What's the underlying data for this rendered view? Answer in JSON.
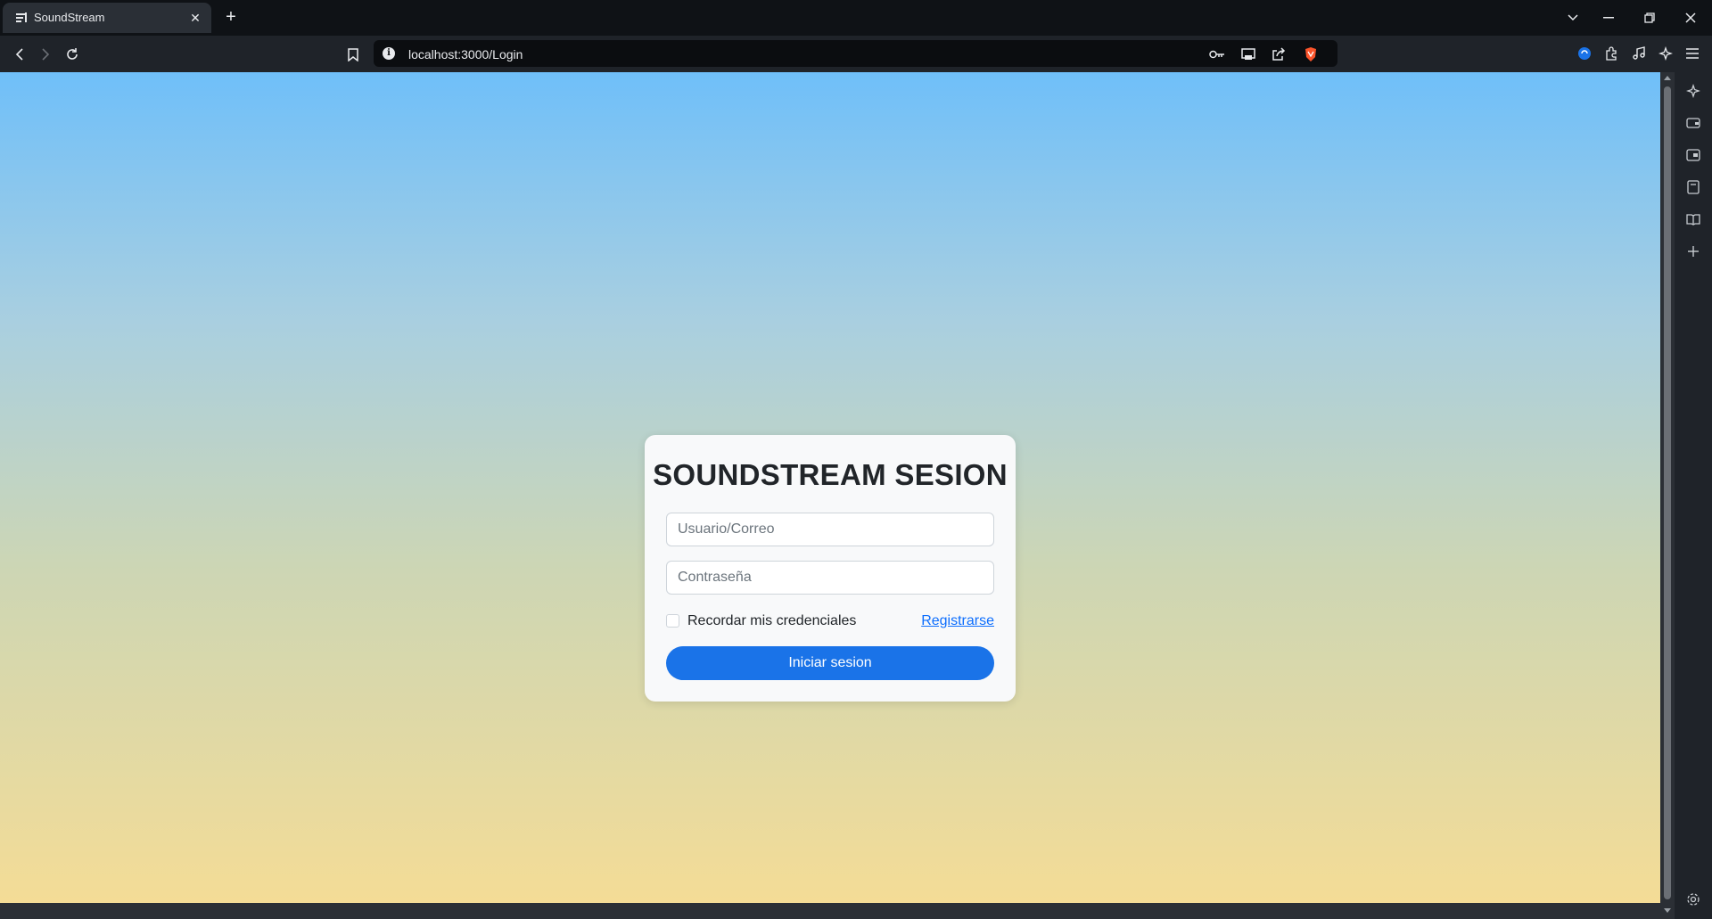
{
  "browser": {
    "tab_title": "SoundStream",
    "url": "localhost:3000/Login"
  },
  "login": {
    "title": "SOUNDSTREAM SESION",
    "username_placeholder": "Usuario/Correo",
    "password_placeholder": "Contraseña",
    "remember_label": "Recordar mis credenciales",
    "register_link": "Registrarse",
    "submit_label": "Iniciar sesion"
  },
  "colors": {
    "gradient_top": "#6fbff9",
    "gradient_bottom": "#f4dc96",
    "primary_button": "#1a73e8",
    "link": "#0d6efd",
    "brave_accent": "#fb542b"
  },
  "icons": {
    "sidebar": [
      "leo-icon",
      "wallet-icon",
      "reading-list-icon",
      "bookmarks-icon",
      "history-icon",
      "add-panel-icon",
      "settings-icon"
    ],
    "toolbar": [
      "back-icon",
      "forward-icon",
      "reload-icon",
      "bookmark-icon",
      "site-info-icon",
      "password-key-icon",
      "cast-icon",
      "share-icon",
      "brave-shields-icon",
      "vpn-icon",
      "extensions-icon",
      "media-icon",
      "leo-ai-icon",
      "menu-icon"
    ]
  }
}
